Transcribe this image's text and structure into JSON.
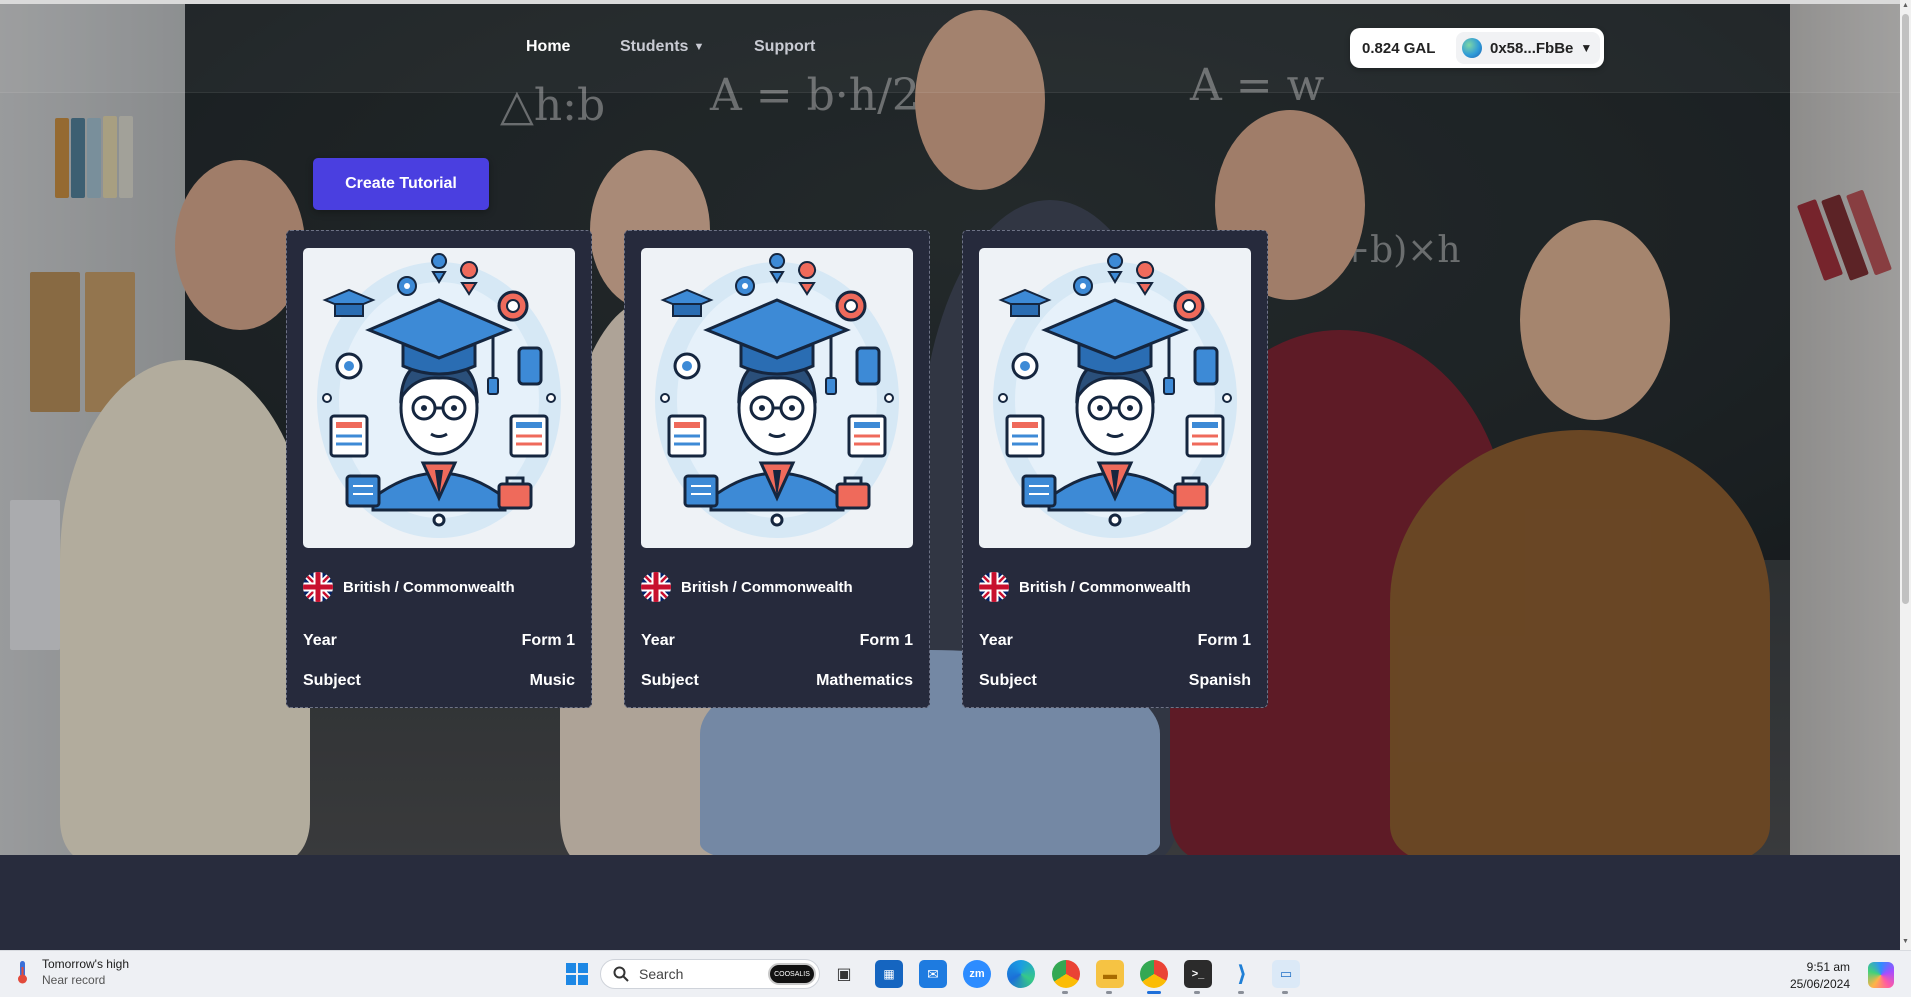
{
  "nav": {
    "links": [
      {
        "label": "Home",
        "active": true
      },
      {
        "label": "Students",
        "has_dropdown": true
      },
      {
        "label": "Support"
      }
    ]
  },
  "wallet": {
    "balance": "0.824 GAL",
    "account": "0x58...FbBe"
  },
  "actions": {
    "create_tutorial": "Create Tutorial"
  },
  "tutorials": [
    {
      "curriculum": "British / Commonwealth",
      "year_label": "Year",
      "year": "Form 1",
      "subject_label": "Subject",
      "subject": "Music"
    },
    {
      "curriculum": "British / Commonwealth",
      "year_label": "Year",
      "year": "Form 1",
      "subject_label": "Subject",
      "subject": "Mathematics"
    },
    {
      "curriculum": "British / Commonwealth",
      "year_label": "Year",
      "year": "Form 1",
      "subject_label": "Subject",
      "subject": "Spanish"
    }
  ],
  "colors": {
    "accent": "#4a3fe0",
    "card_bg": "#262a3c",
    "page_bg": "#282c3d"
  },
  "taskbar": {
    "weather_title": "Tomorrow's high",
    "weather_sub": "Near record",
    "search_placeholder": "Search",
    "time": "9:51 am",
    "date": "25/06/2024",
    "pinned_icons": [
      "windows-start-icon",
      "search-icon",
      "coosalis-app-icon",
      "task-view-icon",
      "store-icon",
      "mail-icon",
      "zoom-icon",
      "edge-icon",
      "chrome-dev-icon",
      "file-explorer-icon",
      "chrome-icon",
      "terminal-icon",
      "vscode-icon",
      "remote-desktop-icon",
      "copilot-icon"
    ]
  }
}
